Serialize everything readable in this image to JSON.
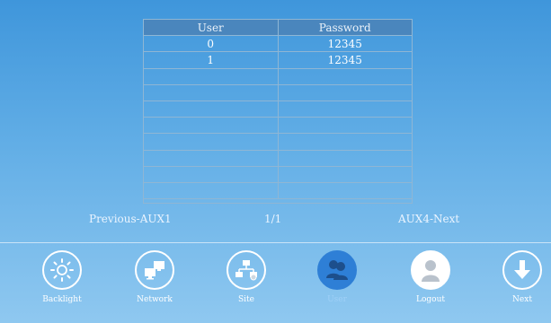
{
  "user_table": {
    "columns": [
      "User",
      "Password"
    ],
    "rows": [
      [
        "0",
        "12345"
      ],
      [
        "1",
        "12345"
      ],
      [
        "",
        ""
      ],
      [
        "",
        ""
      ],
      [
        "",
        ""
      ],
      [
        "",
        ""
      ],
      [
        "",
        ""
      ],
      [
        "",
        ""
      ],
      [
        "",
        ""
      ],
      [
        "",
        ""
      ]
    ]
  },
  "pager": {
    "previous": "Previous-AUX1",
    "page": "1/1",
    "next": "AUX4-Next"
  },
  "toolbar": {
    "items": [
      {
        "label": "Backlight",
        "icon": "sun-icon"
      },
      {
        "label": "Network",
        "icon": "computers-icon"
      },
      {
        "label": "Site",
        "icon": "site-network-icon"
      },
      {
        "label": "User",
        "icon": "users-icon",
        "active": true
      },
      {
        "label": "Logout",
        "icon": "person-icon"
      },
      {
        "label": "Next",
        "icon": "arrow-down-icon"
      }
    ],
    "active_color": "#2e7fd6"
  }
}
